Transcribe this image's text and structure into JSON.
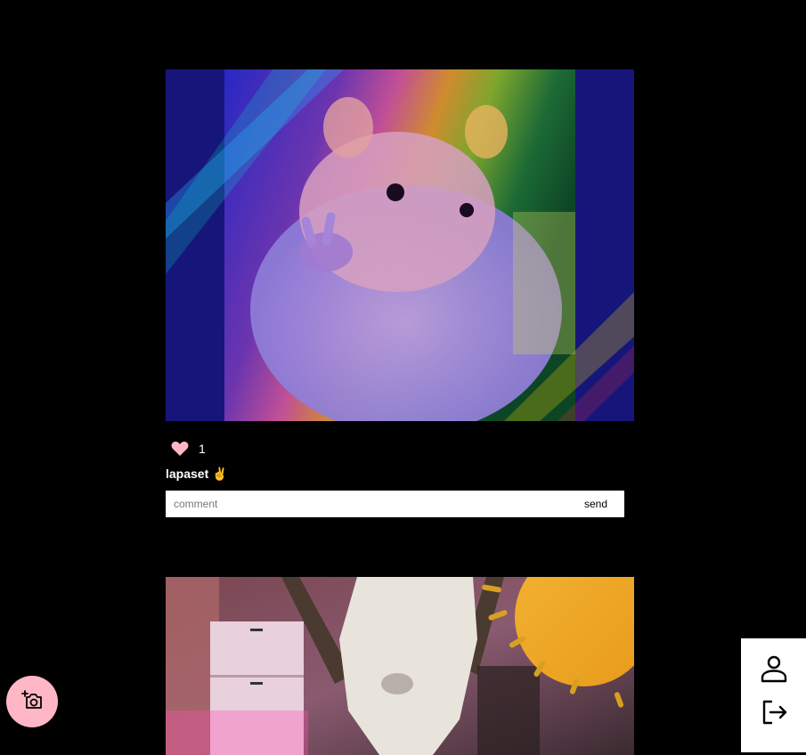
{
  "posts": [
    {
      "image_alt": "",
      "likes": "1",
      "caption": "lapaset ✌️",
      "comment_placeholder": "comment",
      "send_label": "send"
    },
    {
      "image_alt": ""
    }
  ],
  "icons": {
    "like": "heart-icon",
    "add_photo": "camera-plus-icon",
    "profile": "person-icon",
    "logout": "logout-icon"
  },
  "colors": {
    "background": "#000000",
    "heart": "#ffb7c5",
    "fab": "#ffb7c5",
    "menu": "#ffffff"
  }
}
